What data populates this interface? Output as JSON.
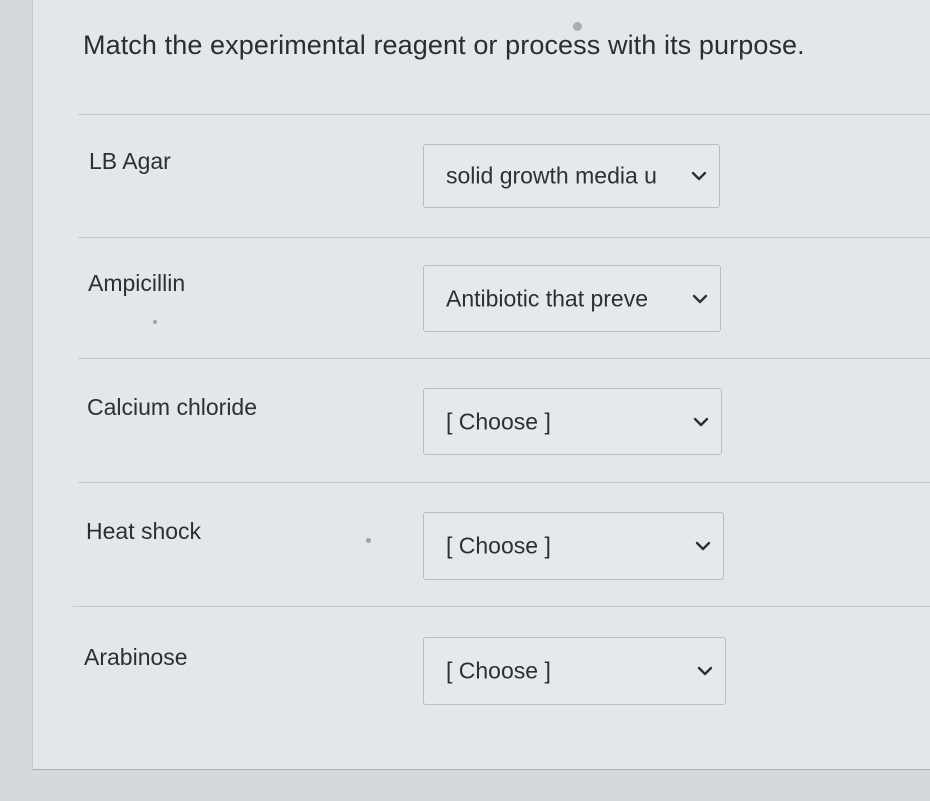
{
  "question": {
    "text": "Match the experimental reagent or process with its purpose."
  },
  "rows": [
    {
      "label": "LB Agar",
      "selected": "solid growth media u"
    },
    {
      "label": "Ampicillin",
      "selected": "Antibiotic that preve"
    },
    {
      "label": "Calcium chloride",
      "selected": "[ Choose ]"
    },
    {
      "label": "Heat shock",
      "selected": "[ Choose ]"
    },
    {
      "label": "Arabinose",
      "selected": "[ Choose ]"
    }
  ],
  "icons": {
    "dropdown": "chevron-down-icon"
  },
  "colors": {
    "background": "#e3e7ea",
    "text": "#2b2e31",
    "border": "#b8bec3"
  }
}
